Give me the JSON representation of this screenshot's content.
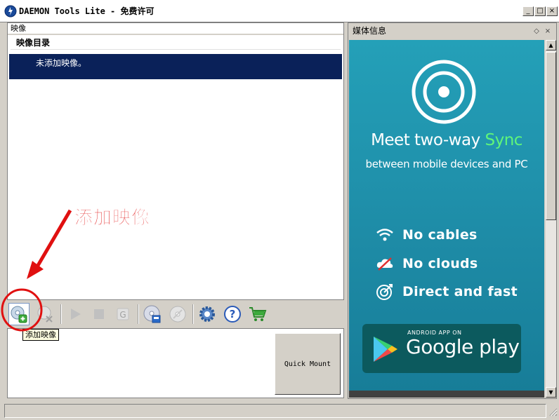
{
  "window": {
    "title": "DAEMON Tools Lite - 免费许可",
    "minimize_label": "_",
    "maximize_label": "□",
    "close_label": "×"
  },
  "images_panel": {
    "header": "映像",
    "catalog_title": "映像目录",
    "empty_message": "未添加映像。"
  },
  "toolbar": {
    "buttons": [
      {
        "name": "add-image",
        "tooltip": "添加映像"
      },
      {
        "name": "remove-image"
      },
      {
        "name": "mount"
      },
      {
        "name": "unmount"
      },
      {
        "name": "grab"
      },
      {
        "name": "add-dt-drive"
      },
      {
        "name": "add-scsi-drive"
      },
      {
        "name": "preferences"
      },
      {
        "name": "help"
      },
      {
        "name": "buy"
      }
    ],
    "tooltip_text": "添加映像"
  },
  "quick_mount": {
    "label": "Quick Mount"
  },
  "annotation": {
    "text": "添加映像",
    "color": "#e01010"
  },
  "media_panel": {
    "header": "媒体信息",
    "ad": {
      "title_main": "Meet two-way ",
      "title_accent": "Sync",
      "subtitle": "between mobile devices and PC",
      "features": [
        "No cables",
        "No clouds",
        "Direct and fast"
      ],
      "badge_small": "ANDROID APP ON",
      "badge_big": "Google play",
      "accent_color": "#5ff57a",
      "background_color": "#1e8ca7"
    }
  }
}
